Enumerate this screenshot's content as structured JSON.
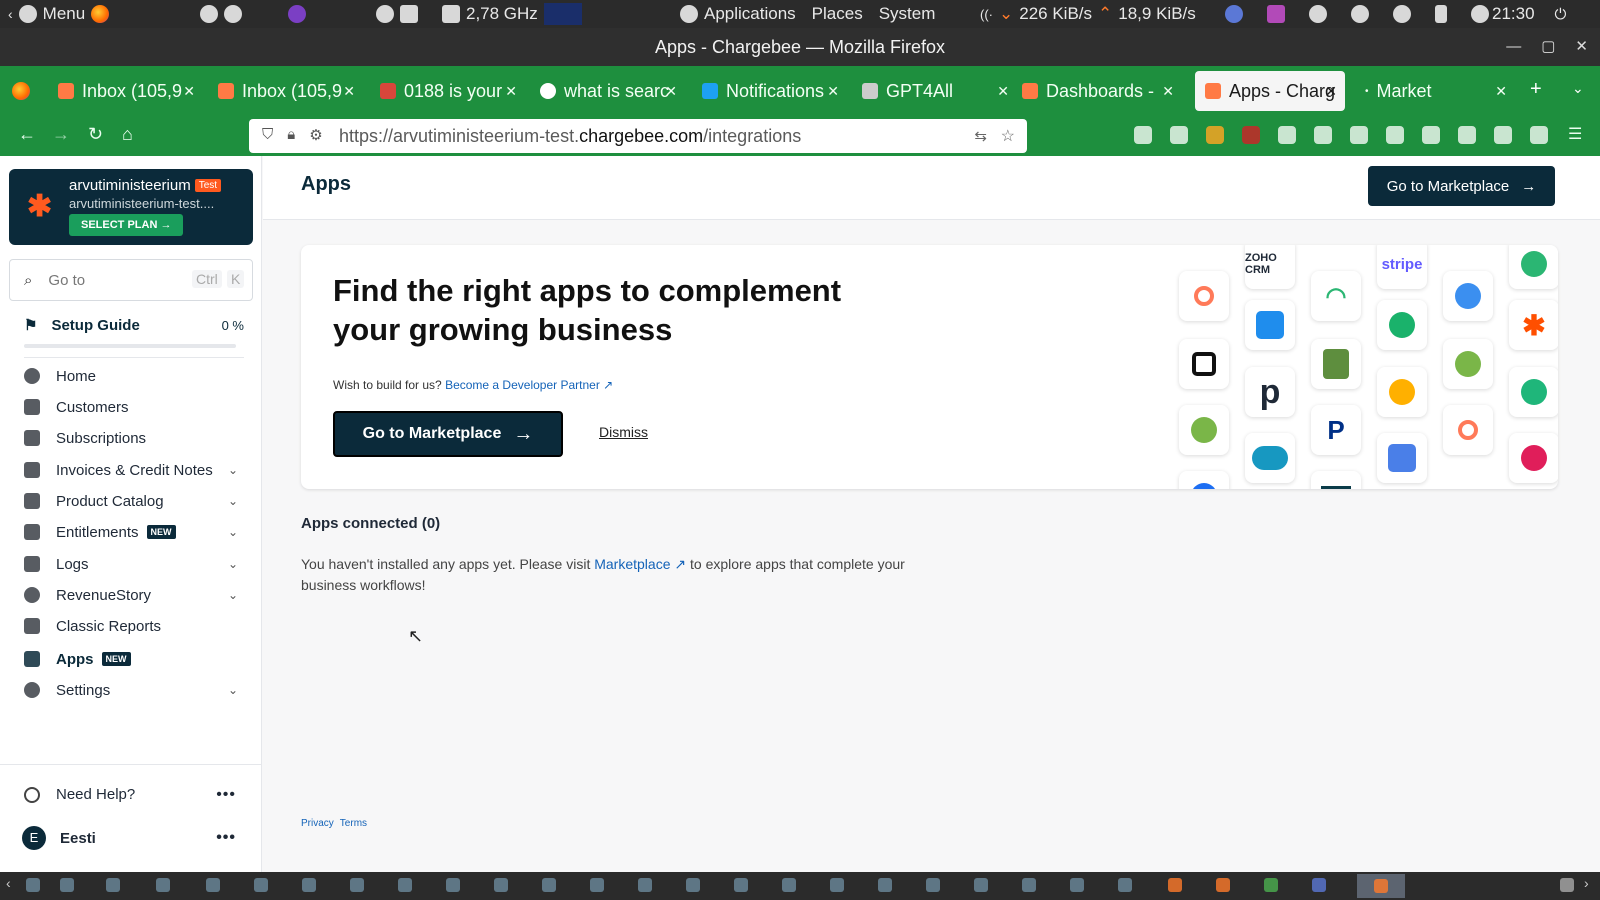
{
  "os_panel": {
    "menu_label": "Menu",
    "cpu_freq": "2,78 GHz",
    "applications": "Applications",
    "places": "Places",
    "system": "System",
    "net_down": "226 KiB/s",
    "net_up": "18,9 KiB/s",
    "clock": "21:30"
  },
  "window": {
    "title": "Apps - Chargebee — Mozilla Firefox"
  },
  "tabs": [
    {
      "label": "Inbox (105,9"
    },
    {
      "label": "Inbox (105,9"
    },
    {
      "label": "0188 is your"
    },
    {
      "label": "what is searc"
    },
    {
      "label": "Notifications"
    },
    {
      "label": "GPT4All"
    },
    {
      "label": "Dashboards -"
    },
    {
      "label": "Apps - Charg"
    },
    {
      "label": "Market"
    }
  ],
  "url": {
    "prefix": "https://arvutiministeerium-test.",
    "domain": "chargebee.com",
    "path": "/integrations"
  },
  "sidebar": {
    "account_name": "arvutiministeerium",
    "account_badge": "Test",
    "account_site": "arvutiministeerium-test....",
    "select_plan": "SELECT PLAN",
    "goto_placeholder": "Go to",
    "goto_kbd1": "Ctrl",
    "goto_kbd2": "K",
    "setup_guide": "Setup Guide",
    "setup_pct": "0 %",
    "setup_progress": 0,
    "items": [
      {
        "label": "Home",
        "icon": "home-icon"
      },
      {
        "label": "Customers",
        "icon": "customers-icon"
      },
      {
        "label": "Subscriptions",
        "icon": "subscriptions-icon"
      },
      {
        "label": "Invoices & Credit Notes",
        "icon": "invoice-icon"
      },
      {
        "label": "Product Catalog",
        "icon": "catalog-icon"
      },
      {
        "label": "Entitlements",
        "icon": "crown-icon",
        "badge": "NEW"
      },
      {
        "label": "Logs",
        "icon": "logs-icon"
      },
      {
        "label": "RevenueStory",
        "icon": "revenue-icon"
      },
      {
        "label": "Classic Reports",
        "icon": "reports-icon"
      },
      {
        "label": "Apps",
        "icon": "apps-grid-icon",
        "badge": "NEW"
      },
      {
        "label": "Settings",
        "icon": "settings-icon"
      }
    ],
    "need_help": "Need Help?",
    "more": "•••",
    "user_initial": "E",
    "user_name": "Eesti"
  },
  "main": {
    "page_title": "Apps",
    "header_button": "Go to Marketplace",
    "hero_title": "Find the right apps to complement your growing business",
    "hero_wish": "Wish to build for us?",
    "hero_link": "Become a Developer Partner",
    "hero_button": "Go to Marketplace",
    "hero_dismiss": "Dismiss",
    "connected_title": "Apps connected (0)",
    "empty_before": "You haven't installed any apps yet. Please visit",
    "empty_link": "Marketplace",
    "empty_after": "to explore apps that complete your business workflows!",
    "tiles": [
      {
        "label": "ZOHO CRM",
        "color": "#222222"
      },
      {
        "label": "stripe",
        "color": "#635bff"
      }
    ],
    "footer_privacy": "Privacy",
    "footer_terms": "Terms"
  },
  "colors": {
    "brand_dark": "#0b2a3a",
    "accent_orange": "#ff5a1f",
    "browser_green": "#1e8f3e",
    "link_blue": "#1463b8"
  }
}
